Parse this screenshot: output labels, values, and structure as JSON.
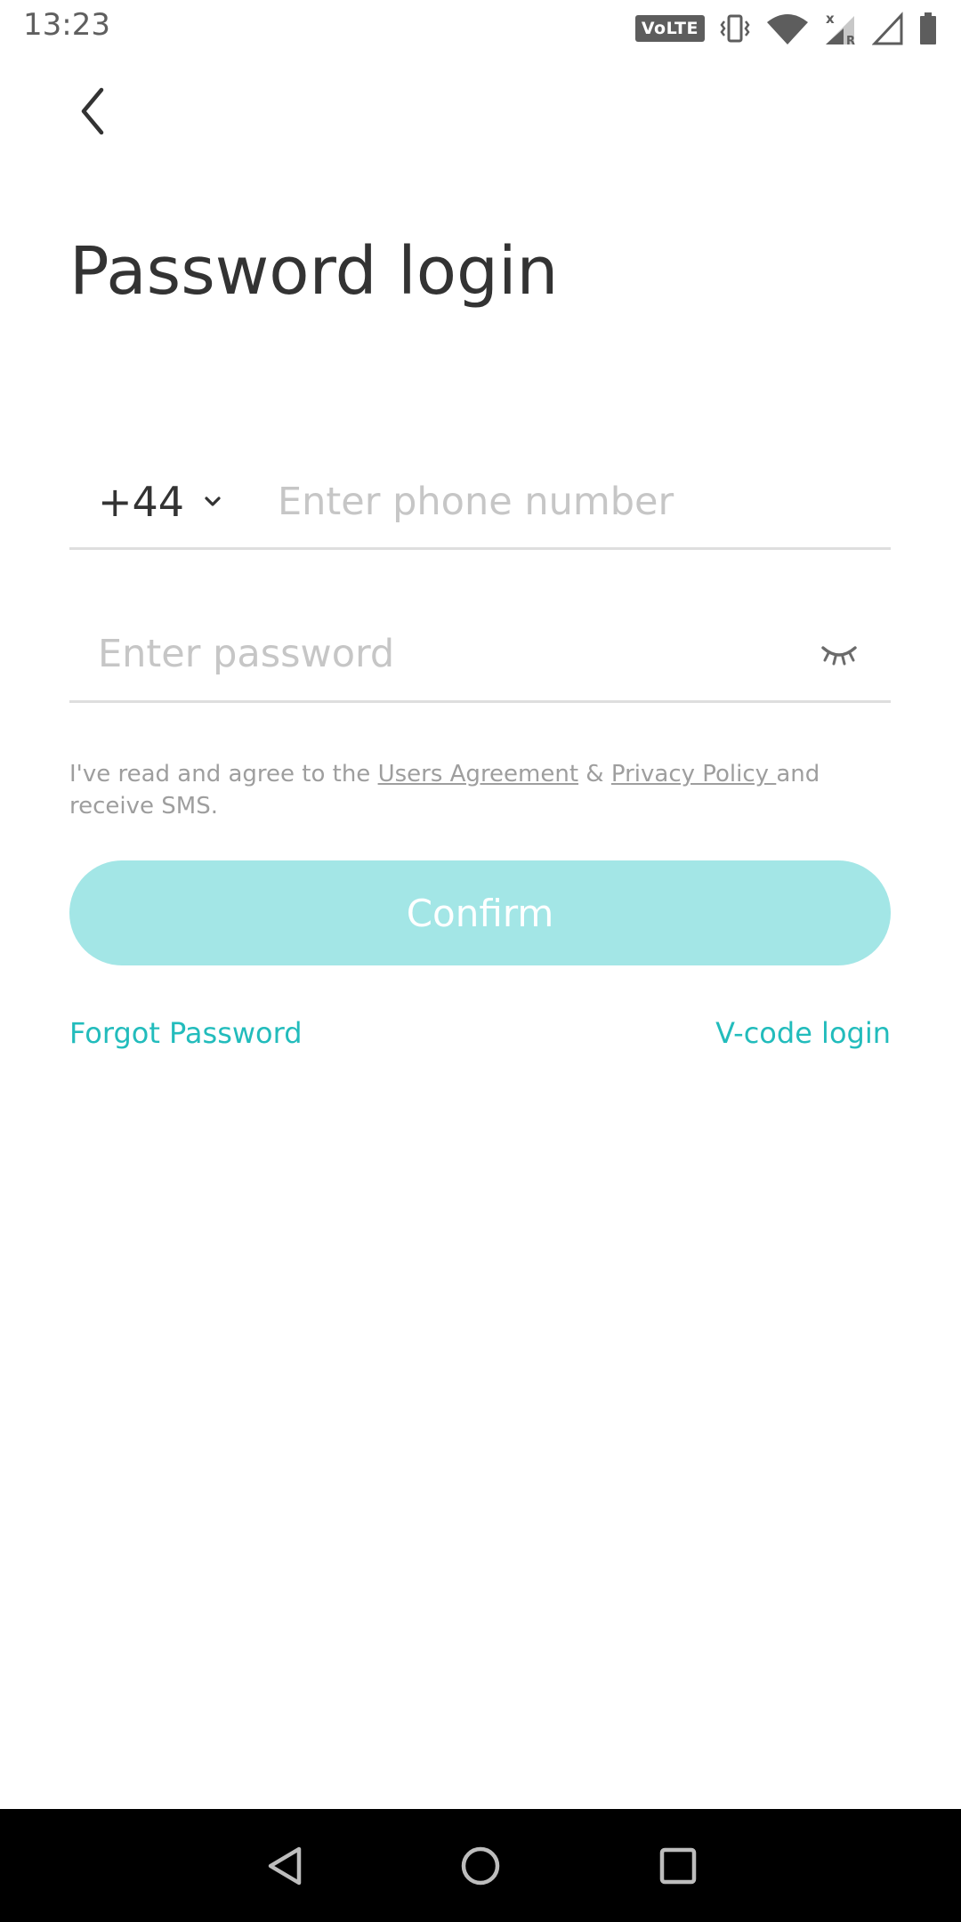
{
  "status_bar": {
    "time": "13:23",
    "volte_label": "VoLTE",
    "icons": [
      "volte-icon",
      "vibrate-icon",
      "wifi-icon",
      "signal-roaming-icon",
      "signal-icon",
      "battery-icon"
    ]
  },
  "header": {
    "back_icon": "chevron-left-icon",
    "title": "Password login"
  },
  "phone_field": {
    "country_code": "+44",
    "dropdown_icon": "chevron-down-icon",
    "value": "",
    "placeholder": "Enter phone number"
  },
  "password_field": {
    "value": "",
    "placeholder": "Enter password",
    "toggle_icon": "eye-closed-icon"
  },
  "agreement": {
    "prefix": "I've read and agree to the ",
    "users_agreement": "Users Agreement",
    "ampersand": " & ",
    "privacy_policy": "Privacy Policy ",
    "suffix": "and receive SMS."
  },
  "confirm_button": {
    "label": "Confirm"
  },
  "links": {
    "forgot_password": "Forgot Password",
    "vcode_login": "V-code login"
  },
  "colors": {
    "accent": "#22bcbc",
    "button_disabled": "#a3e6e6",
    "title": "#333333",
    "placeholder": "#c6c6c6",
    "divider": "#dedede"
  },
  "nav_bar": {
    "icons": [
      "nav-back-icon",
      "nav-home-icon",
      "nav-recents-icon"
    ]
  }
}
